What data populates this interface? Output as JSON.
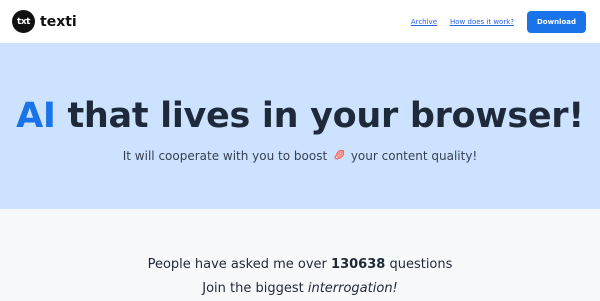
{
  "header": {
    "logo_badge": "txt",
    "brand_name": "texti",
    "nav": {
      "archive": "Archive",
      "how": "How does it work?"
    },
    "download_label": "Download"
  },
  "hero": {
    "title_accent": "AI",
    "title_rest": " that lives in your browser!",
    "sub_before": "It will cooperate with you to boost",
    "sub_after": "your content quality!",
    "icon": "rocket-icon"
  },
  "stats": {
    "line1_before": "People have asked me over ",
    "count": "130638",
    "line1_after": " questions",
    "line2_before": "Join the biggest ",
    "line2_emphasis": "interrogation!"
  },
  "colors": {
    "accent": "#1a73e8",
    "hero_bg": "#cce2ff",
    "stats_bg": "#f7f8fa"
  }
}
